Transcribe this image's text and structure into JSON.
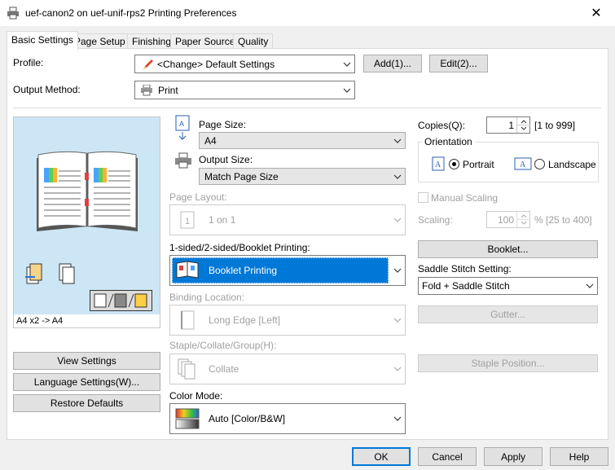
{
  "window": {
    "title": "uef-canon2 on uef-unif-rps2 Printing Preferences",
    "close_glyph": "✕"
  },
  "tabs": [
    "Basic Settings",
    "Page Setup",
    "Finishing",
    "Paper Source",
    "Quality"
  ],
  "profile": {
    "label": "Profile:",
    "value": "<Change> Default Settings",
    "add": "Add(1)...",
    "edit": "Edit(2)..."
  },
  "output_method": {
    "label": "Output Method:",
    "value": "Print"
  },
  "preview": {
    "caption": "A4 x2 -> A4"
  },
  "left_buttons": {
    "view": "View Settings",
    "language": "Language Settings(W)...",
    "restore": "Restore Defaults"
  },
  "page_size": {
    "label": "Page Size:",
    "value": "A4"
  },
  "output_size": {
    "label": "Output Size:",
    "value": "Match Page Size"
  },
  "page_layout": {
    "label": "Page Layout:",
    "value": "1 on 1"
  },
  "printing": {
    "label": "1-sided/2-sided/Booklet Printing:",
    "value": "Booklet Printing"
  },
  "binding": {
    "label": "Binding Location:",
    "value": "Long Edge [Left]"
  },
  "staple": {
    "label": "Staple/Collate/Group(H):",
    "value": "Collate"
  },
  "color_mode": {
    "label": "Color Mode:",
    "value": "Auto [Color/B&W]"
  },
  "copies": {
    "label": "Copies(Q):",
    "value": "1",
    "range": "[1 to 999]"
  },
  "orientation": {
    "label": "Orientation",
    "portrait": "Portrait",
    "landscape": "Landscape"
  },
  "manual_scaling": {
    "label": "Manual Scaling"
  },
  "scaling": {
    "label": "Scaling:",
    "value": "100",
    "range": "% [25 to 400]"
  },
  "booklet_button": "Booklet...",
  "saddle": {
    "label": "Saddle Stitch Setting:",
    "value": "Fold + Saddle Stitch"
  },
  "gutter_button": "Gutter...",
  "staple_position_button": "Staple Position...",
  "footer": {
    "ok": "OK",
    "cancel": "Cancel",
    "apply": "Apply",
    "help": "Help"
  },
  "colors": {
    "accent": "#0078d7",
    "preview_bg": "#cce6f5"
  }
}
